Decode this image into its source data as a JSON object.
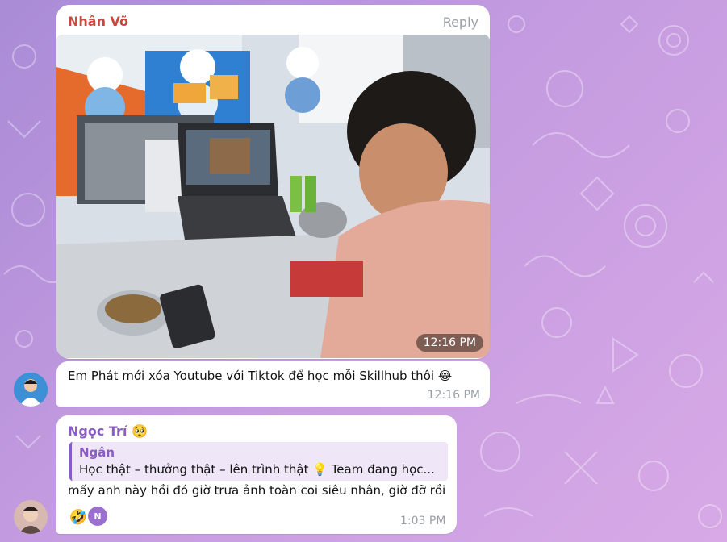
{
  "chat": {
    "message1": {
      "sender": "Nhân Võ",
      "reply_label": "Reply",
      "photo_time": "12:16 PM",
      "text": "Em Phát mới xóa Youtube với Tiktok để học mỗi Skillhub thôi 😂",
      "time": "12:16 PM"
    },
    "message2": {
      "sender": "Ngọc Trí",
      "sender_emoji": "🥺",
      "quote_author": "Ngân",
      "quote_text": "Học thật – thưởng thật – lên trình thật 💡 Team đang học...",
      "text": "mấy anh này hồi đó giờ trưa ảnh toàn coi siêu nhân, giờ đỡ rồi",
      "reaction_emoji": "🤣",
      "reactor_initial": "N",
      "time": "1:03 PM"
    }
  },
  "colors": {
    "sender1": "#c9473d",
    "sender2": "#8a5cc4",
    "reactor_badge": "#9b6fd0"
  }
}
